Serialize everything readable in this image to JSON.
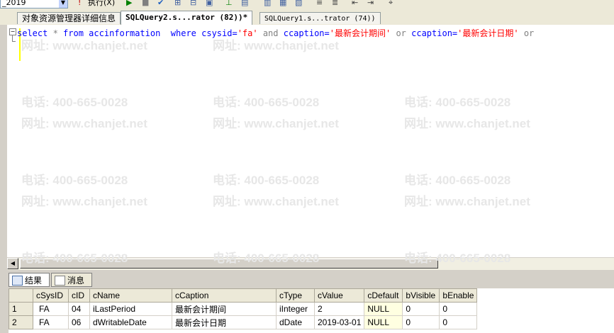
{
  "toolbar": {
    "database": "_2019",
    "execute_label": "执行(X)"
  },
  "tabs": [
    {
      "label": "对象资源管理器详细信息"
    },
    {
      "label": "SQLQuery2.s...rator (82))*"
    },
    {
      "label": "SQLQuery1.s...trator (74))"
    }
  ],
  "editor": {
    "line1": {
      "t1": "select",
      "t2": " * ",
      "t3": "from",
      "t4": " accinformation  ",
      "t5": "where",
      "t6": " csysid=",
      "t7": "'fa'",
      "t8": " and ",
      "t9": "ccaption=",
      "t10": "'最新会计期间'",
      "t11": " or ",
      "t12": "ccaption=",
      "t13": "'最新会计日期'",
      "t14": " or"
    }
  },
  "watermark": {
    "phone": "电话: 400-665-0028",
    "site": "网址: www.chanjet.net"
  },
  "result_tabs": {
    "results": "结果",
    "messages": "消息"
  },
  "grid": {
    "columns": [
      "cSysID",
      "cID",
      "cName",
      "cCaption",
      "cType",
      "cValue",
      "cDefault",
      "bVisible",
      "bEnable"
    ],
    "rows": [
      {
        "num": "1",
        "cSysID": "FA",
        "cID": "04",
        "cName": "iLastPeriod",
        "cCaption": "最新会计期间",
        "cType": "iInteger",
        "cValue": "2",
        "cDefault": "NULL",
        "bVisible": "0",
        "bEnable": "0"
      },
      {
        "num": "2",
        "cSysID": "FA",
        "cID": "06",
        "cName": "dWritableDate",
        "cCaption": "最新会计日期",
        "cType": "dDate",
        "cValue": "2019-03-01",
        "cDefault": "NULL",
        "bVisible": "0",
        "bEnable": "0"
      }
    ]
  }
}
